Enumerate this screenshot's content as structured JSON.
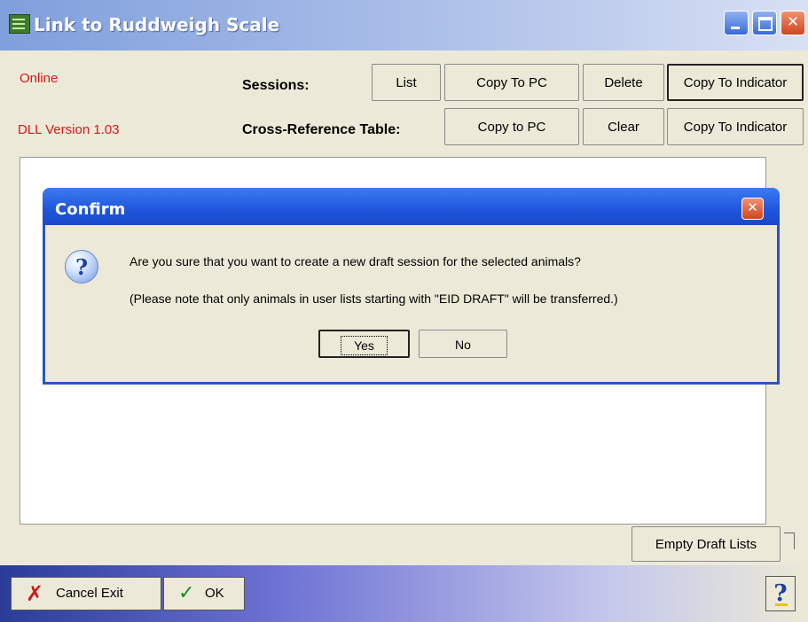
{
  "window": {
    "title": "Link to Ruddweigh Scale"
  },
  "status": {
    "connection": "Online",
    "dll_version": "DLL Version 1.03"
  },
  "sessions": {
    "label": "Sessions:",
    "buttons": {
      "list": "List",
      "copy_to_pc": "Copy To PC",
      "delete": "Delete",
      "copy_to_indicator": "Copy To Indicator"
    }
  },
  "cross_reference": {
    "label": "Cross-Reference Table:",
    "buttons": {
      "copy_to_pc": "Copy to PC",
      "clear": "Clear",
      "copy_to_indicator": "Copy To  Indicator"
    }
  },
  "dialog": {
    "title": "Confirm",
    "icon": "question-icon",
    "message": "Are you sure that you want to create a new draft session for the selected animals?",
    "note": "(Please note that only animals in user lists starting with \"EID DRAFT\" will be transferred.)",
    "yes_label": "Yes",
    "no_label": "No"
  },
  "empty_draft_lists_label": "Empty Draft Lists",
  "footer": {
    "cancel_label": "Cancel Exit",
    "ok_label": "OK",
    "help_label": "?"
  },
  "colors": {
    "status_red": "#d81818",
    "dialog_blue": "#2a54c4",
    "window_bg": "#ece9d8"
  }
}
